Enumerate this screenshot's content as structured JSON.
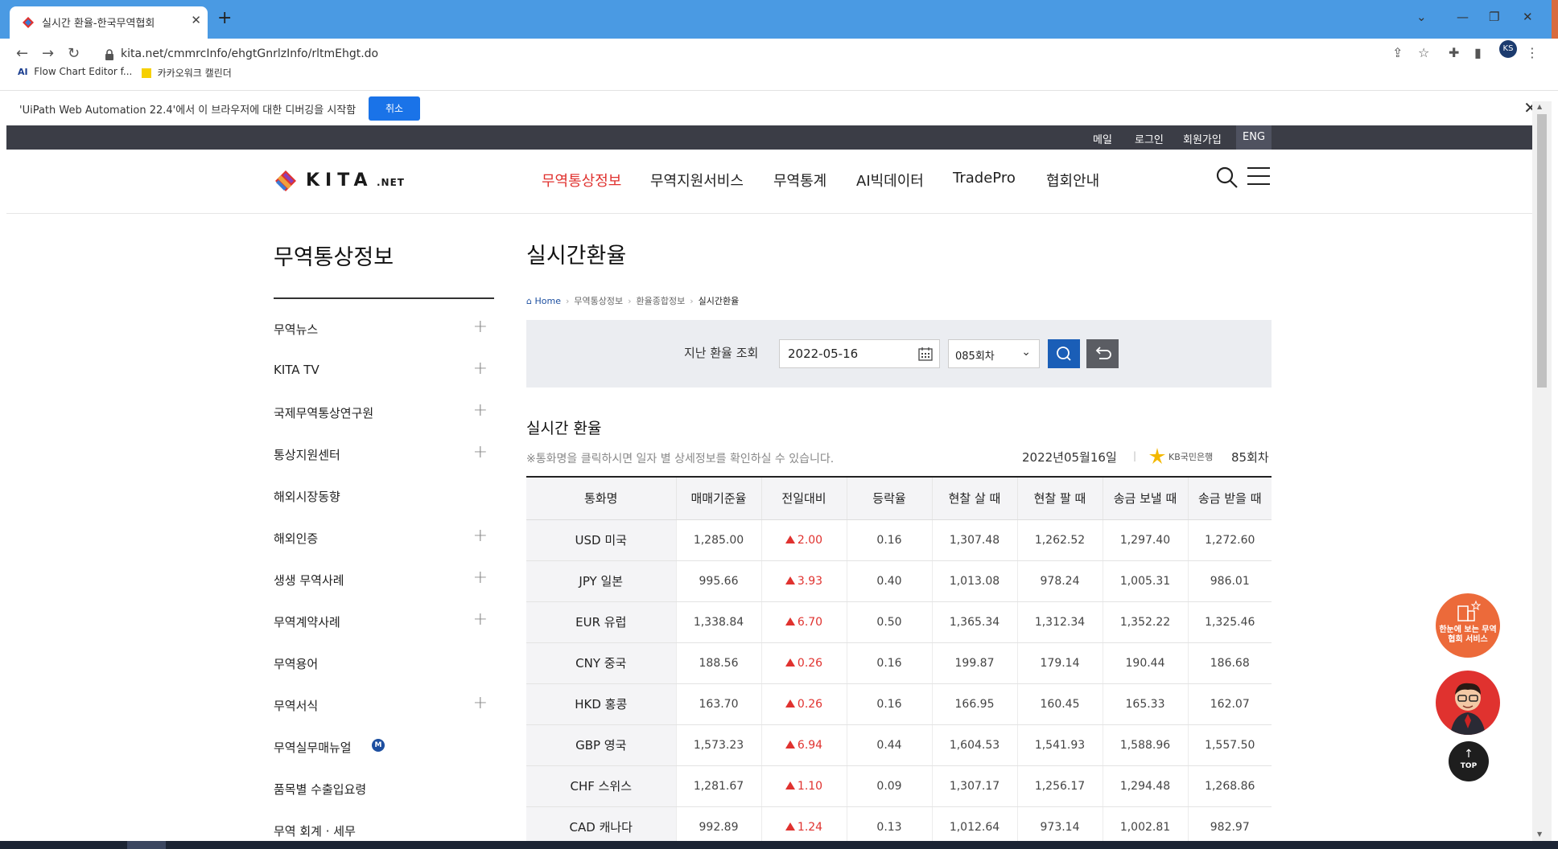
{
  "browser": {
    "tab_title": "실시간 환율-한국무역협회",
    "url": "kita.net/cmmrcInfo/ehgtGnrlzInfo/rltmEhgt.do",
    "bookmarks": [
      "Flow Chart Editor f...",
      "카카오워크 캘린더"
    ],
    "profile_initials": "KS",
    "infobar_message": "'UiPath Web Automation 22.4'에서 이 브라우저에 대한 디버깅을 시작함",
    "infobar_button": "취소"
  },
  "utility_links": [
    "메일",
    "로그인",
    "회원가입",
    "ENG"
  ],
  "logo": {
    "text": "KITA",
    "suffix": ".NET"
  },
  "main_menu": [
    {
      "label": "무역통상정보",
      "active": true
    },
    {
      "label": "무역지원서비스",
      "active": false
    },
    {
      "label": "무역통계",
      "active": false
    },
    {
      "label": "AI빅데이터",
      "active": false
    },
    {
      "label": "TradePro",
      "active": false
    },
    {
      "label": "협회안내",
      "active": false
    }
  ],
  "sidebar": {
    "title": "무역통상정보",
    "items": [
      {
        "label": "무역뉴스",
        "expandable": true
      },
      {
        "label": "KITA TV",
        "expandable": true
      },
      {
        "label": "국제무역통상연구원",
        "expandable": true
      },
      {
        "label": "통상지원센터",
        "expandable": true
      },
      {
        "label": "해외시장동향",
        "expandable": false
      },
      {
        "label": "해외인증",
        "expandable": true
      },
      {
        "label": "생생 무역사례",
        "expandable": true
      },
      {
        "label": "무역계약사례",
        "expandable": true
      },
      {
        "label": "무역용어",
        "expandable": false
      },
      {
        "label": "무역서식",
        "expandable": true
      },
      {
        "label": "무역실무매뉴얼",
        "expandable": false,
        "badge": "M"
      },
      {
        "label": "품목별 수출입요령",
        "expandable": false
      },
      {
        "label": "무역 회계 · 세무",
        "expandable": false
      }
    ]
  },
  "content": {
    "title": "실시간환율",
    "breadcrumb": [
      "Home",
      "무역통상정보",
      "환율종합정보",
      "실시간환율"
    ],
    "search": {
      "label": "지난 환율 조회",
      "date": "2022-05-16",
      "round": "085회차"
    },
    "section_title": "실시간 환율",
    "note": "※통화명을 클릭하시면 일자 별 상세정보를 확인하실 수 있습니다.",
    "date_text": "2022년05월16일",
    "bank": "KB국민은행",
    "bank_round": "85회차",
    "table": {
      "headers": [
        "통화명",
        "매매기준율",
        "전일대비",
        "등락율",
        "현찰 살 때",
        "현찰 팔 때",
        "송금 보낼 때",
        "송금 받을 때"
      ],
      "rows": [
        [
          "USD 미국",
          "1,285.00",
          "2.00",
          "0.16",
          "1,307.48",
          "1,262.52",
          "1,297.40",
          "1,272.60"
        ],
        [
          "JPY 일본",
          "995.66",
          "3.93",
          "0.40",
          "1,013.08",
          "978.24",
          "1,005.31",
          "986.01"
        ],
        [
          "EUR 유럽",
          "1,338.84",
          "6.70",
          "0.50",
          "1,365.34",
          "1,312.34",
          "1,352.22",
          "1,325.46"
        ],
        [
          "CNY 중국",
          "188.56",
          "0.26",
          "0.16",
          "199.87",
          "179.14",
          "190.44",
          "186.68"
        ],
        [
          "HKD 홍콩",
          "163.70",
          "0.26",
          "0.16",
          "166.95",
          "160.45",
          "165.33",
          "162.07"
        ],
        [
          "GBP 영국",
          "1,573.23",
          "6.94",
          "0.44",
          "1,604.53",
          "1,541.93",
          "1,588.96",
          "1,557.50"
        ],
        [
          "CHF 스위스",
          "1,281.67",
          "1.10",
          "0.09",
          "1,307.17",
          "1,256.17",
          "1,294.48",
          "1,268.86"
        ],
        [
          "CAD 캐나다",
          "992.89",
          "1.24",
          "0.13",
          "1,012.64",
          "973.14",
          "1,002.81",
          "982.97"
        ]
      ]
    }
  },
  "floating": {
    "service_label": "한눈에 보는 무역협회 서비스",
    "top_label": "TOP"
  },
  "colors": {
    "accent_red": "#e0322f",
    "primary_blue": "#1a5eb7",
    "top_strip": "#3b3d46"
  }
}
